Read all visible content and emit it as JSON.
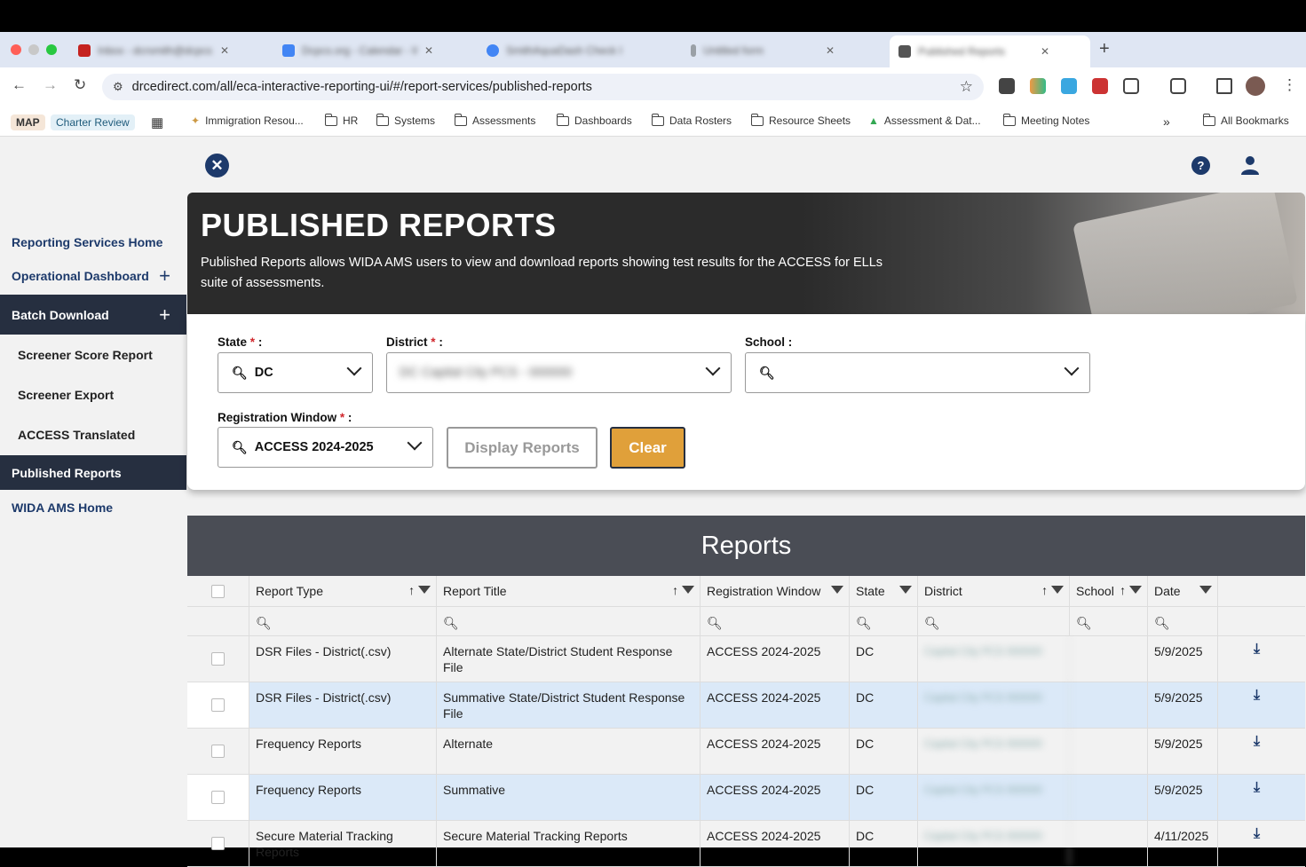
{
  "browser": {
    "tabs": [
      {
        "title": "Inbox - dcrsmith@dcpcs.org",
        "color": "#c5221f"
      },
      {
        "title": "Dcpcs.org - Calendar - Week",
        "color": "#4285f4"
      },
      {
        "title": "SmithAquaDash Check In Ins",
        "color": "#4285f4"
      },
      {
        "title": "Untitled form",
        "color": "#9aa0a6"
      },
      {
        "title": "Published Reports",
        "color": "#555555",
        "active": true
      }
    ],
    "url": "drcedirect.com/all/eca-interactive-reporting-ui/#/report-services/published-reports",
    "bookmarks": [
      "MAP",
      "Charter Review",
      "Immigration Resou...",
      "HR",
      "Systems",
      "Assessments",
      "Dashboards",
      "Data Rosters",
      "Resource Sheets",
      "Assessment & Dat...",
      "Meeting Notes",
      "All Bookmarks"
    ]
  },
  "sidebar": {
    "items": [
      {
        "label": "Reporting Services Home"
      },
      {
        "label": "Operational Dashboard"
      },
      {
        "label": "Batch Download"
      },
      {
        "label": "Screener Score Report"
      },
      {
        "label": "Screener Export"
      },
      {
        "label": "ACCESS Translated"
      },
      {
        "label": "Published Reports"
      },
      {
        "label": "WIDA AMS Home"
      }
    ]
  },
  "hero": {
    "title": "PUBLISHED REPORTS",
    "description": "Published Reports allows WIDA AMS users to view and download reports showing test results for the ACCESS for ELLs suite of assessments."
  },
  "filters": {
    "state_label": "State",
    "state_value": "DC",
    "district_label": "District",
    "district_value": "DC Capital City PCS - 000000",
    "school_label": "School",
    "school_value": "",
    "window_label": "Registration Window",
    "window_value": "ACCESS 2024-2025",
    "required_mark": "*",
    "colon": ":",
    "display_button": "Display Reports",
    "clear_button": "Clear"
  },
  "reports": {
    "heading": "Reports",
    "columns": [
      "Report Type",
      "Report Title",
      "Registration Window",
      "State",
      "District",
      "School",
      "Date"
    ],
    "rows": [
      {
        "type": "DSR Files - District(.csv)",
        "title": "Alternate State/District Student Response File",
        "window": "ACCESS 2024-2025",
        "state": "DC",
        "district": "Capital City PCS 000000",
        "school": "",
        "date": "5/9/2025"
      },
      {
        "type": "DSR Files - District(.csv)",
        "title": "Summative State/District Student Response File",
        "window": "ACCESS 2024-2025",
        "state": "DC",
        "district": "Capital City PCS 000000",
        "school": "",
        "date": "5/9/2025"
      },
      {
        "type": "Frequency Reports",
        "title": "Alternate",
        "window": "ACCESS 2024-2025",
        "state": "DC",
        "district": "Capital City PCS 000000",
        "school": "",
        "date": "5/9/2025"
      },
      {
        "type": "Frequency Reports",
        "title": "Summative",
        "window": "ACCESS 2024-2025",
        "state": "DC",
        "district": "Capital City PCS 000000",
        "school": "",
        "date": "5/9/2025"
      },
      {
        "type": "Secure Material Tracking Reports",
        "title": "Secure Material Tracking Reports",
        "window": "ACCESS 2024-2025",
        "state": "DC",
        "district": "Capital City PCS 000000",
        "school": "",
        "date": "4/11/2025"
      }
    ]
  },
  "colors": {
    "navy": "#1d3a6b",
    "dark_bar": "#262f40",
    "clear_button": "#e0a03a",
    "required": "#d0262c",
    "row_highlight": "#dbe9f8"
  }
}
